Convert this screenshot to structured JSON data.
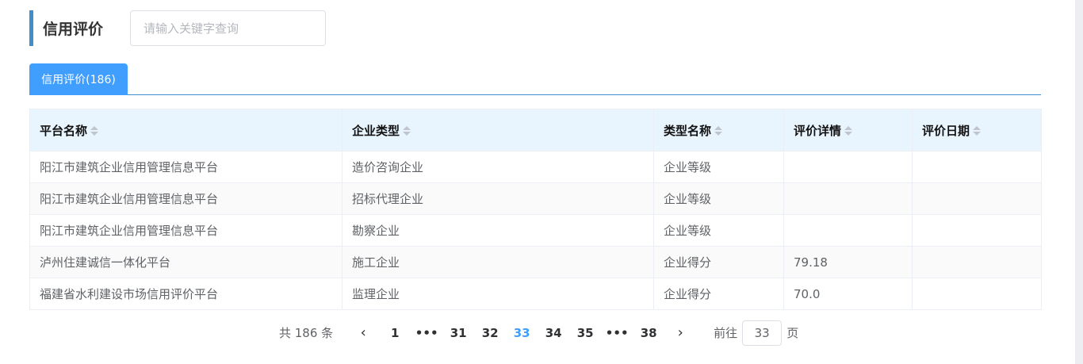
{
  "header": {
    "title": "信用评价",
    "search_placeholder": "请输入关键字查询"
  },
  "tabs": [
    {
      "label": "信用评价(186)",
      "active": true
    }
  ],
  "table": {
    "columns": [
      "平台名称",
      "企业类型",
      "类型名称",
      "评价详情",
      "评价日期"
    ],
    "rows": [
      [
        "阳江市建筑企业信用管理信息平台",
        "造价咨询企业",
        "企业等级",
        "",
        ""
      ],
      [
        "阳江市建筑企业信用管理信息平台",
        "招标代理企业",
        "企业等级",
        "",
        ""
      ],
      [
        "阳江市建筑企业信用管理信息平台",
        "勘察企业",
        "企业等级",
        "",
        ""
      ],
      [
        "泸州住建诚信一体化平台",
        "施工企业",
        "企业得分",
        "79.18",
        ""
      ],
      [
        "福建省水利建设市场信用评价平台",
        "监理企业",
        "企业得分",
        "70.0",
        ""
      ]
    ]
  },
  "pagination": {
    "total_text": "共 186 条",
    "prev_icon": "chevron-left-icon",
    "next_icon": "chevron-right-icon",
    "pages": [
      "1",
      "•••",
      "31",
      "32",
      "33",
      "34",
      "35",
      "•••",
      "38"
    ],
    "current": "33",
    "goto_label": "前往",
    "goto_value": "33",
    "goto_suffix": "页"
  },
  "colors": {
    "accent": "#409eff",
    "header_bar": "#3e8ed0",
    "table_header_bg": "#e9f5fe"
  }
}
